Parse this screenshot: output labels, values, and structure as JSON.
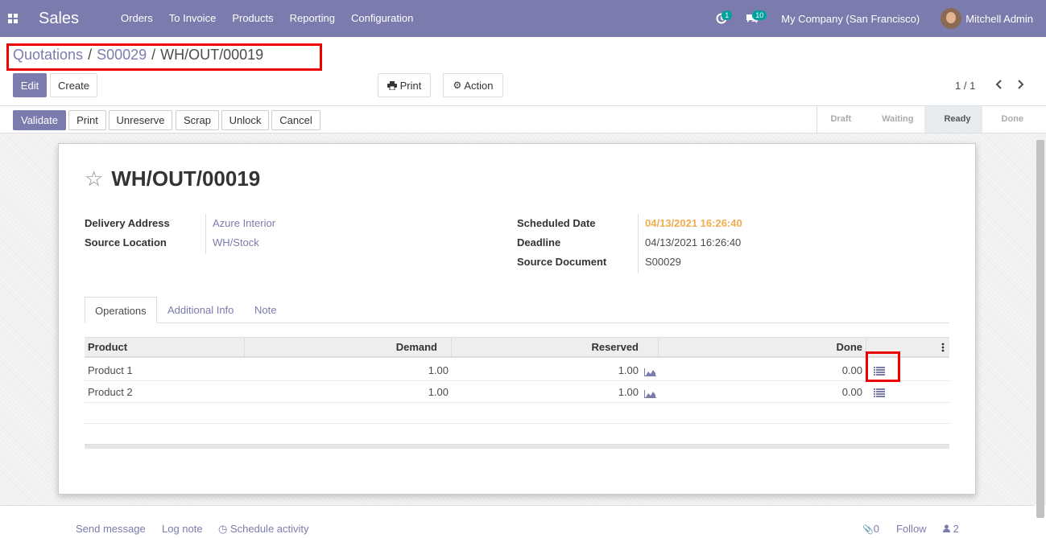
{
  "navbar": {
    "app_name": "Sales",
    "menu": [
      "Orders",
      "To Invoice",
      "Products",
      "Reporting",
      "Configuration"
    ],
    "activity_count": "1",
    "message_count": "10",
    "company": "My Company (San Francisco)",
    "user": "Mitchell Admin"
  },
  "breadcrumb": {
    "items": [
      "Quotations",
      "S00029",
      "WH/OUT/00019"
    ],
    "separator": "/"
  },
  "control_panel": {
    "edit_label": "Edit",
    "create_label": "Create",
    "print_label": "Print",
    "action_label": "Action",
    "pager": "1 / 1"
  },
  "statusbar": {
    "buttons": [
      "Validate",
      "Print",
      "Unreserve",
      "Scrap",
      "Unlock",
      "Cancel"
    ],
    "stages": [
      "Draft",
      "Waiting",
      "Ready",
      "Done"
    ],
    "active_stage": "Ready"
  },
  "record": {
    "name": "WH/OUT/00019",
    "delivery_address_label": "Delivery Address",
    "delivery_address": "Azure Interior",
    "source_location_label": "Source Location",
    "source_location": "WH/Stock",
    "scheduled_date_label": "Scheduled Date",
    "scheduled_date": "04/13/2021 16:26:40",
    "deadline_label": "Deadline",
    "deadline": "04/13/2021 16:26:40",
    "source_document_label": "Source Document",
    "source_document": "S00029"
  },
  "tabs": [
    "Operations",
    "Additional Info",
    "Note"
  ],
  "operations": {
    "columns": [
      "Product",
      "Demand",
      "Reserved",
      "Done"
    ],
    "rows": [
      {
        "product": "Product 1",
        "demand": "1.00",
        "reserved": "1.00",
        "done": "0.00"
      },
      {
        "product": "Product 2",
        "demand": "1.00",
        "reserved": "1.00",
        "done": "0.00"
      }
    ]
  },
  "chatter": {
    "send_message": "Send message",
    "log_note": "Log note",
    "schedule_activity": "Schedule activity",
    "attachments": "0",
    "follow": "Follow",
    "followers": "2"
  },
  "colors": {
    "primary": "#7c7bad",
    "warning": "#f0ad4e",
    "highlight": "#e00000"
  }
}
